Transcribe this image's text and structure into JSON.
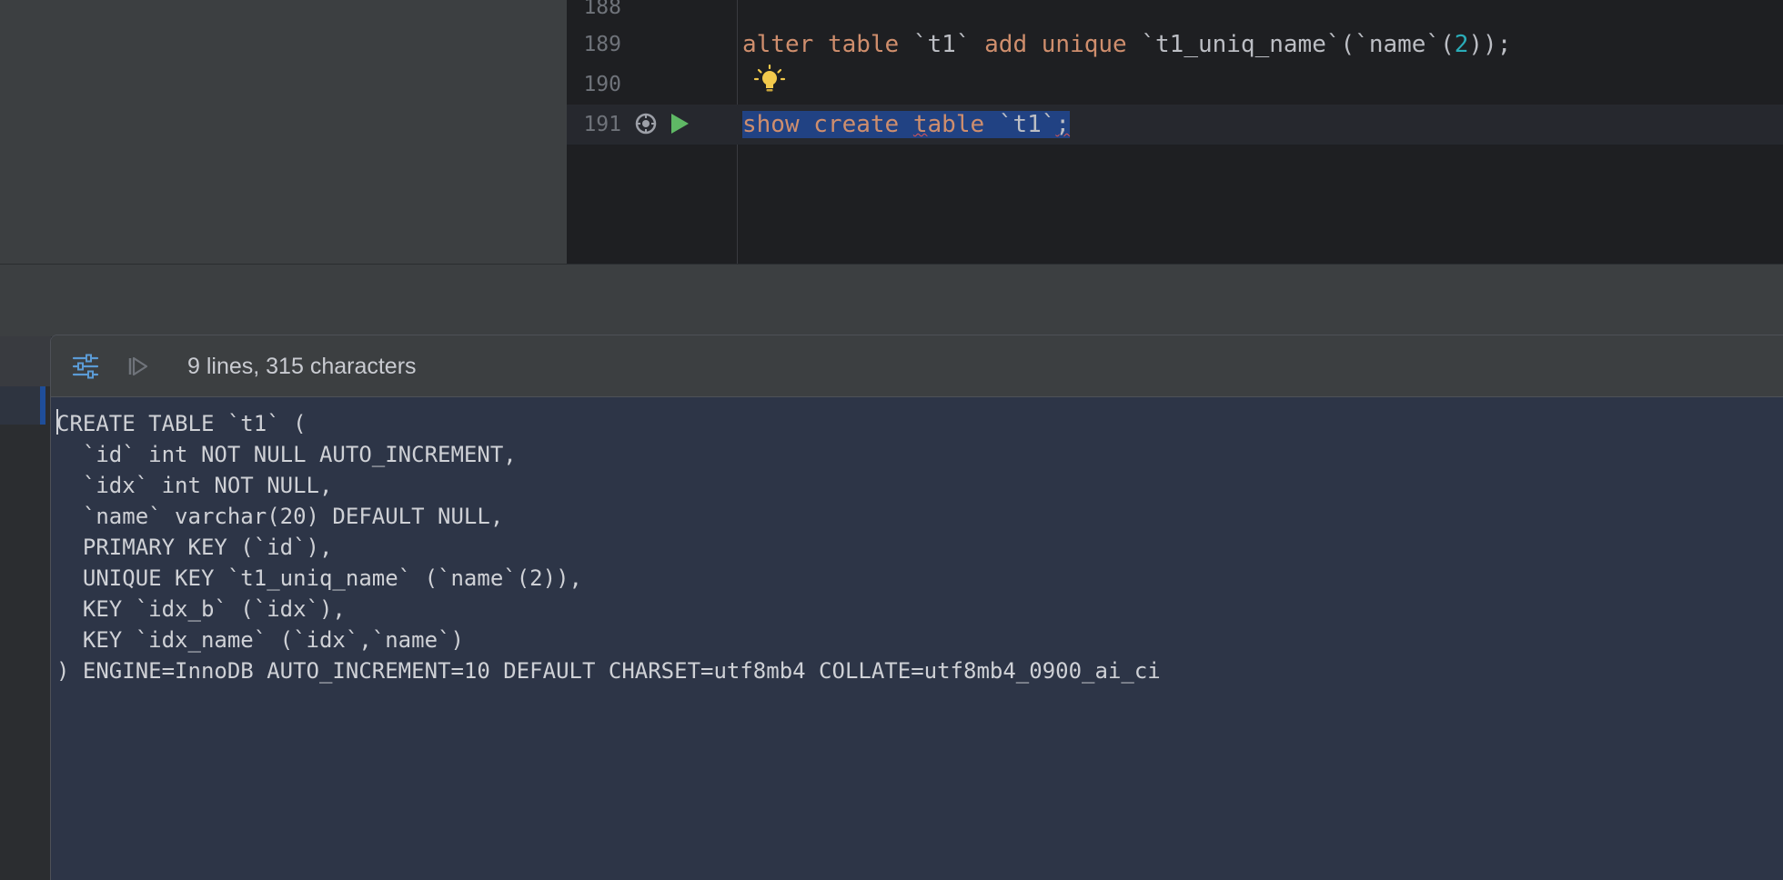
{
  "editor": {
    "lines": [
      {
        "no": "188",
        "code": ""
      },
      {
        "no": "189",
        "code": "alter table `t1` add unique `t1_uniq_name`(`name`(2));"
      },
      {
        "no": "190",
        "code": ""
      },
      {
        "no": "191",
        "code": "show create table `t1`;"
      }
    ],
    "line189": {
      "kw1": "alter",
      "kw2": "table",
      "ident1": "`t1`",
      "kw3": "add",
      "kw4": "unique",
      "ident2": "`t1_uniq_name`(`name`(",
      "num": "2",
      "tail": "));"
    },
    "line191": {
      "kw1": "show",
      "kw2": "create",
      "kw3_a": "t",
      "kw3_b": "able",
      "ident": "`t1`",
      "tail": ";"
    }
  },
  "popup": {
    "title": "9 lines, 315 characters",
    "output_lines": [
      "CREATE TABLE `t1` (",
      "  `id` int NOT NULL AUTO_INCREMENT,",
      "  `idx` int NOT NULL,",
      "  `name` varchar(20) DEFAULT NULL,",
      "  PRIMARY KEY (`id`),",
      "  UNIQUE KEY `t1_uniq_name` (`name`(2)),",
      "  KEY `idx_b` (`idx`),",
      "  KEY `idx_name` (`idx`,`name`)",
      ") ENGINE=InnoDB AUTO_INCREMENT=10 DEFAULT CHARSET=utf8mb4 COLLATE=utf8mb4_0900_ai_ci"
    ]
  },
  "colors": {
    "keyword": "#cf8e6d",
    "number": "#2aacb8",
    "selection": "#214283",
    "run_green": "#5fb865",
    "bulb_yellow": "#f2c94c"
  },
  "icons": [
    "settings-sliders-icon",
    "play-disabled-icon",
    "lightbulb-icon",
    "execution-options-icon",
    "run-icon"
  ]
}
